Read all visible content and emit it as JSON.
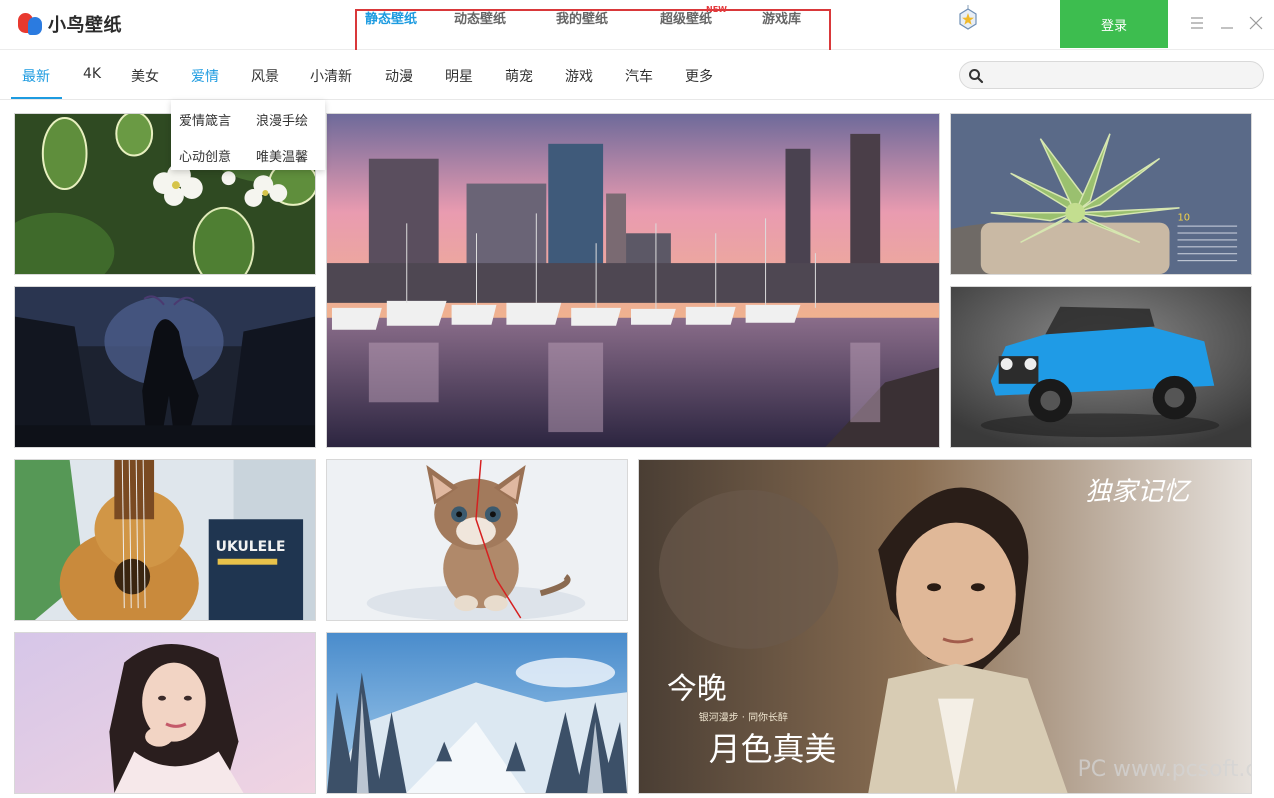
{
  "app": {
    "name": "小鸟壁纸"
  },
  "main_tabs": [
    {
      "label": "静态壁纸",
      "active": true
    },
    {
      "label": "动态壁纸",
      "active": false
    },
    {
      "label": "我的壁纸",
      "active": false
    },
    {
      "label": "超级壁纸",
      "active": false
    },
    {
      "label": "游戏库",
      "active": false
    }
  ],
  "new_badge": "NEW",
  "login_label": "登录",
  "window_controls": [
    "menu-icon",
    "minimize-icon",
    "close-icon"
  ],
  "categories": [
    {
      "label": "最新",
      "active": true
    },
    {
      "label": "4K"
    },
    {
      "label": "美女"
    },
    {
      "label": "爱情",
      "hover": true
    },
    {
      "label": "风景"
    },
    {
      "label": "小清新"
    },
    {
      "label": "动漫"
    },
    {
      "label": "明星"
    },
    {
      "label": "萌宠"
    },
    {
      "label": "游戏"
    },
    {
      "label": "汽车"
    },
    {
      "label": "更多"
    }
  ],
  "dropdown": [
    "爱情箴言",
    "浪漫手绘",
    "心动创意",
    "唯美温馨"
  ],
  "search": {
    "placeholder": ""
  },
  "wallpapers": {
    "calendar_month": "10",
    "ukulele_label": "UKULELE",
    "poster_title": "独家记忆",
    "poster_line1": "今晚",
    "poster_line2": "月色真美",
    "poster_small": "银河漫步 · 同你长醉",
    "watermark": "PC www.pcsoft.com.cn"
  },
  "colors": {
    "accent": "#1d9be0",
    "login_green": "#3dbd4f",
    "highlight_box": "#d9383a",
    "new_badge": "#e4393c"
  }
}
